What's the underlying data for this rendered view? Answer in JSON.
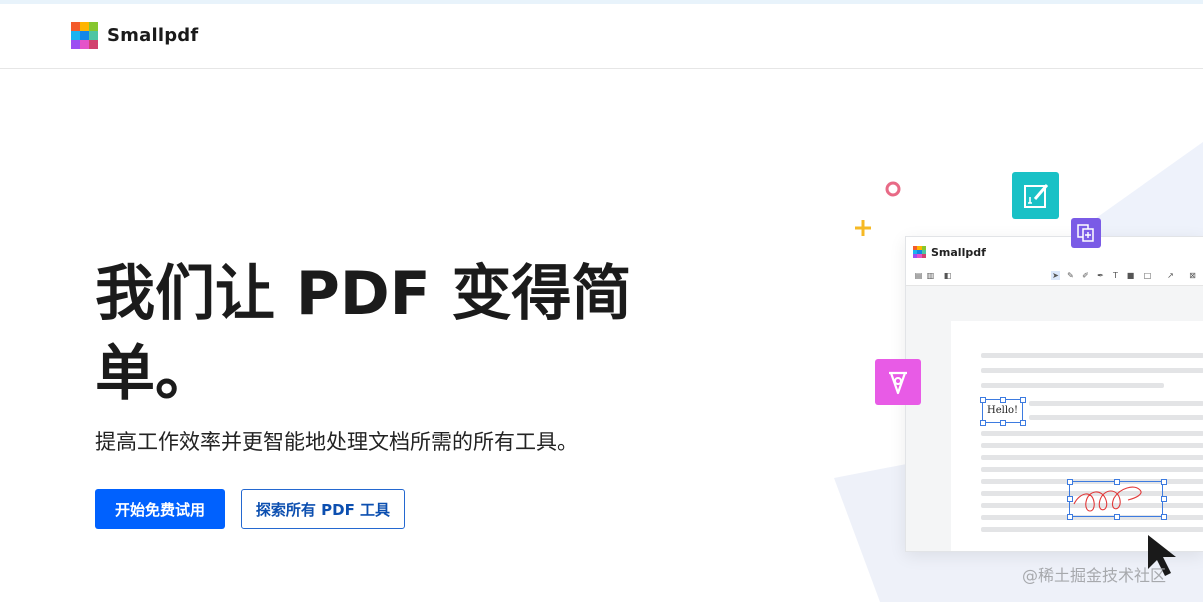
{
  "header": {
    "brand": "Smallpdf",
    "logo_colors": [
      "#f35b2b",
      "#ffb400",
      "#86c72f",
      "#19b3f0",
      "#1287e8",
      "#4ec5a3",
      "#9c4ff2",
      "#e552c9",
      "#d2426e"
    ]
  },
  "hero": {
    "title": "我们让 PDF 变得简单。",
    "subtitle": "提高工作效率并更智能地处理文档所需的所有工具。",
    "cta_primary": "开始免费试用",
    "cta_secondary": "探索所有 PDF 工具"
  },
  "illustration": {
    "app_name": "Smallpdf",
    "hello_text": "Hello!",
    "icons": [
      "sign-edit-icon",
      "pages-icon",
      "pen-nib-icon",
      "plus-icon",
      "ring-icon",
      "cursor-arrow-icon"
    ]
  },
  "watermark": "@稀土掘金技术社区",
  "colors": {
    "primary": "#0061fe",
    "secondary_border": "#2468d0",
    "teal_tile": "#19c1c6",
    "purple_tile": "#7a5be6",
    "magenta_tile": "#e85be6",
    "ring": "#e86a86",
    "plus": "#f6b924"
  }
}
